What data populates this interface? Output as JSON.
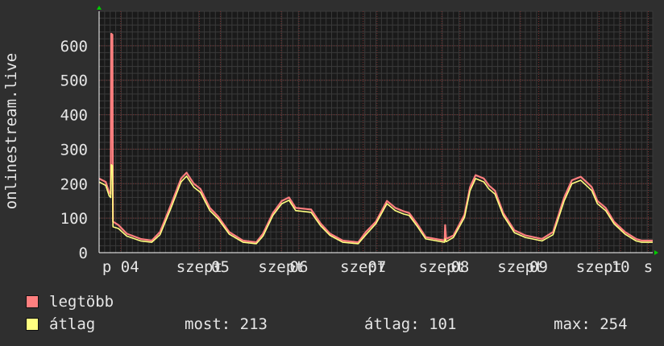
{
  "chart_data": {
    "type": "line",
    "ylabel": "onlinestream.live",
    "ylim": [
      0,
      700
    ],
    "yticks": [
      0,
      100,
      200,
      300,
      400,
      500,
      600
    ],
    "xlim": [
      0,
      100
    ],
    "xticks": [
      {
        "x": 3.9,
        "label": "p 04"
      },
      {
        "x": 18.1,
        "label": "szept"
      },
      {
        "x": 21.9,
        "label": "05"
      },
      {
        "x": 32.9,
        "label": "szept"
      },
      {
        "x": 36.1,
        "label": "06"
      },
      {
        "x": 47.7,
        "label": "szept"
      },
      {
        "x": 50.2,
        "label": "07"
      },
      {
        "x": 61.9,
        "label": "szept"
      },
      {
        "x": 65.2,
        "label": "08"
      },
      {
        "x": 76.1,
        "label": "szept"
      },
      {
        "x": 79.4,
        "label": "09"
      },
      {
        "x": 90.3,
        "label": "szept"
      },
      {
        "x": 94.2,
        "label": "10"
      },
      {
        "x": 99.2,
        "label": "s"
      }
    ],
    "grid": true,
    "series": [
      {
        "name": "legtöbb",
        "color": "#ff7f7f",
        "points": [
          [
            0,
            215
          ],
          [
            1.2,
            205
          ],
          [
            1.8,
            175
          ],
          [
            2.1,
            170
          ],
          [
            2.2,
            635
          ],
          [
            2.4,
            632
          ],
          [
            2.5,
            90
          ],
          [
            3.5,
            80
          ],
          [
            5.0,
            55
          ],
          [
            7.5,
            40
          ],
          [
            9.5,
            35
          ],
          [
            11.0,
            60
          ],
          [
            13.0,
            140
          ],
          [
            14.8,
            215
          ],
          [
            15.8,
            232
          ],
          [
            17.1,
            200
          ],
          [
            18.3,
            185
          ],
          [
            20.0,
            130
          ],
          [
            21.5,
            105
          ],
          [
            23.5,
            60
          ],
          [
            26.0,
            35
          ],
          [
            28.4,
            30
          ],
          [
            29.6,
            55
          ],
          [
            31.4,
            115
          ],
          [
            33.0,
            150
          ],
          [
            34.3,
            160
          ],
          [
            35.5,
            130
          ],
          [
            38.3,
            125
          ],
          [
            40.0,
            85
          ],
          [
            41.7,
            55
          ],
          [
            44.0,
            35
          ],
          [
            46.8,
            30
          ],
          [
            48.2,
            60
          ],
          [
            50.0,
            90
          ],
          [
            52.0,
            150
          ],
          [
            53.5,
            130
          ],
          [
            55.0,
            120
          ],
          [
            56.0,
            115
          ],
          [
            57.4,
            85
          ],
          [
            59.0,
            45
          ],
          [
            62.4,
            35
          ],
          [
            62.5,
            80
          ],
          [
            62.7,
            40
          ],
          [
            64.0,
            50
          ],
          [
            66.0,
            110
          ],
          [
            67.0,
            190
          ],
          [
            68.0,
            225
          ],
          [
            69.5,
            215
          ],
          [
            70.4,
            195
          ],
          [
            71.5,
            180
          ],
          [
            73.0,
            115
          ],
          [
            75.0,
            65
          ],
          [
            77.0,
            50
          ],
          [
            80.0,
            40
          ],
          [
            82.0,
            60
          ],
          [
            84.0,
            160
          ],
          [
            85.4,
            210
          ],
          [
            87.0,
            220
          ],
          [
            88.0,
            205
          ],
          [
            89.0,
            190
          ],
          [
            90.0,
            150
          ],
          [
            91.5,
            130
          ],
          [
            93.0,
            90
          ],
          [
            95.0,
            60
          ],
          [
            97.0,
            40
          ],
          [
            98.0,
            35
          ],
          [
            100.0,
            35
          ]
        ]
      },
      {
        "name": "átlag",
        "color": "#ffff80",
        "points": [
          [
            0,
            205
          ],
          [
            1.2,
            195
          ],
          [
            1.8,
            165
          ],
          [
            2.1,
            160
          ],
          [
            2.2,
            255
          ],
          [
            2.4,
            252
          ],
          [
            2.5,
            75
          ],
          [
            3.5,
            70
          ],
          [
            5.0,
            48
          ],
          [
            7.5,
            34
          ],
          [
            9.5,
            30
          ],
          [
            11.0,
            52
          ],
          [
            13.0,
            130
          ],
          [
            14.8,
            205
          ],
          [
            15.8,
            222
          ],
          [
            17.1,
            190
          ],
          [
            18.3,
            175
          ],
          [
            20.0,
            122
          ],
          [
            21.5,
            98
          ],
          [
            23.5,
            54
          ],
          [
            26.0,
            30
          ],
          [
            28.4,
            26
          ],
          [
            29.6,
            48
          ],
          [
            31.4,
            108
          ],
          [
            33.0,
            142
          ],
          [
            34.3,
            152
          ],
          [
            35.5,
            122
          ],
          [
            38.3,
            117
          ],
          [
            40.0,
            78
          ],
          [
            41.7,
            50
          ],
          [
            44.0,
            30
          ],
          [
            46.8,
            26
          ],
          [
            48.2,
            52
          ],
          [
            50.0,
            84
          ],
          [
            52.0,
            142
          ],
          [
            53.5,
            122
          ],
          [
            55.0,
            112
          ],
          [
            56.0,
            108
          ],
          [
            57.4,
            78
          ],
          [
            59.0,
            40
          ],
          [
            62.4,
            30
          ],
          [
            62.5,
            40
          ],
          [
            62.7,
            32
          ],
          [
            64.0,
            44
          ],
          [
            66.0,
            102
          ],
          [
            67.0,
            180
          ],
          [
            68.0,
            215
          ],
          [
            69.5,
            205
          ],
          [
            70.4,
            185
          ],
          [
            71.5,
            170
          ],
          [
            73.0,
            108
          ],
          [
            75.0,
            58
          ],
          [
            77.0,
            44
          ],
          [
            80.0,
            34
          ],
          [
            82.0,
            52
          ],
          [
            84.0,
            150
          ],
          [
            85.4,
            200
          ],
          [
            87.0,
            210
          ],
          [
            88.0,
            195
          ],
          [
            89.0,
            180
          ],
          [
            90.0,
            142
          ],
          [
            91.5,
            122
          ],
          [
            93.0,
            84
          ],
          [
            95.0,
            54
          ],
          [
            97.0,
            34
          ],
          [
            98.0,
            30
          ],
          [
            100.0,
            30
          ]
        ]
      }
    ]
  },
  "legend": {
    "max_name": "legtöbb",
    "avg_name": "átlag",
    "max_color": "#ff7f7f",
    "avg_color": "#ffff80"
  },
  "stats": {
    "current": "most: 213",
    "average": "átlag: 101",
    "max": "max: 254"
  }
}
